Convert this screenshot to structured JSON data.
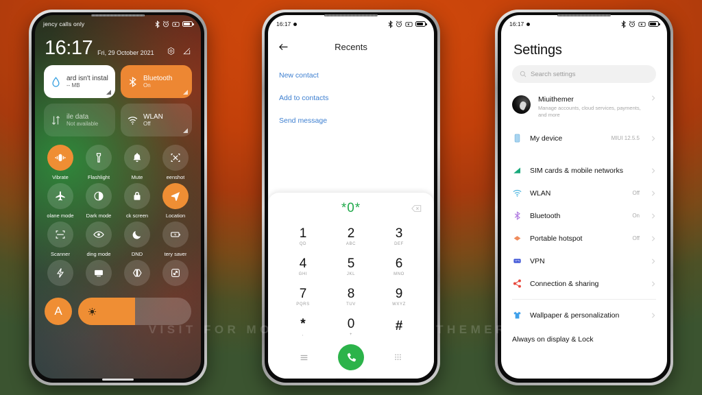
{
  "background": {
    "top_color": "#c9420b",
    "bottom_color": "#37522f"
  },
  "watermark": {
    "text": "VISIT FOR MORE THEMES - MIUITHEMER.COM"
  },
  "phone1": {
    "name": "control-center",
    "statusbar": {
      "carrier": "jency calls only",
      "icons": [
        "bluetooth-icon",
        "alarm-icon",
        "vibrate-icon",
        "battery-icon"
      ]
    },
    "clock": {
      "time": "16:17",
      "date": "Fri, 29 October 2021"
    },
    "header_icons": [
      "settings-gear-icon",
      "edit-icon"
    ],
    "tiles": [
      {
        "title": "ard isn't instal",
        "subtitle": "-- MB",
        "icon": "water-drop-icon",
        "style": "white"
      },
      {
        "title": "Bluetooth",
        "subtitle": "On",
        "icon": "bluetooth-icon",
        "style": "orange"
      },
      {
        "title": "ile data",
        "subtitle": "Not available",
        "icon": "data-arrows-icon",
        "style": "dimgreen"
      },
      {
        "title": "WLAN",
        "subtitle": "Off",
        "icon": "wifi-icon",
        "style": "dimgrey"
      }
    ],
    "toggles": [
      {
        "label": "Vibrate",
        "icon": "vibrate-icon",
        "active": true
      },
      {
        "label": "Flashlight",
        "icon": "flashlight-icon",
        "active": false
      },
      {
        "label": "Mute",
        "icon": "bell-icon",
        "active": false
      },
      {
        "label": "eenshot",
        "icon": "screenshot-icon",
        "active": false
      },
      {
        "label": "olane mode",
        "icon": "airplane-icon",
        "active": false
      },
      {
        "label": "Dark mode",
        "icon": "contrast-icon",
        "active": false
      },
      {
        "label": "ck screen",
        "icon": "lock-icon",
        "active": false
      },
      {
        "label": "Location",
        "icon": "location-arrow-icon",
        "active": true
      },
      {
        "label": "Scanner",
        "icon": "scan-frame-icon",
        "active": false
      },
      {
        "label": "ding mode",
        "icon": "eye-icon",
        "active": false
      },
      {
        "label": "DND",
        "icon": "moon-icon",
        "active": false
      },
      {
        "label": "tery saver",
        "icon": "battery-saver-icon",
        "active": false
      },
      {
        "label": "",
        "icon": "lightning-icon",
        "active": false
      },
      {
        "label": "",
        "icon": "cast-icon",
        "active": false
      },
      {
        "label": "",
        "icon": "ultra-battery-icon",
        "active": false
      },
      {
        "label": "",
        "icon": "rotate-screen-icon",
        "active": false
      }
    ],
    "brightness": {
      "auto_label": "A",
      "icon": "sun-icon",
      "level_percent": 50
    }
  },
  "phone2": {
    "name": "dialer",
    "statusbar": {
      "time": "16:17",
      "icons": [
        "bluetooth-icon",
        "alarm-icon",
        "vibrate-icon",
        "battery-icon"
      ]
    },
    "appbar": {
      "back_icon": "back-arrow-icon",
      "title": "Recents"
    },
    "links": [
      "New contact",
      "Add to contacts",
      "Send message"
    ],
    "dial_display": {
      "value": "*0*",
      "backspace_icon": "backspace-icon"
    },
    "keys": [
      {
        "digit": "1",
        "letters": "QD"
      },
      {
        "digit": "2",
        "letters": "ABC"
      },
      {
        "digit": "3",
        "letters": "DEF"
      },
      {
        "digit": "4",
        "letters": "GHI"
      },
      {
        "digit": "5",
        "letters": "JKL"
      },
      {
        "digit": "6",
        "letters": "MNO"
      },
      {
        "digit": "7",
        "letters": "PQRS"
      },
      {
        "digit": "8",
        "letters": "TUV"
      },
      {
        "digit": "9",
        "letters": "WXYZ"
      },
      {
        "digit": "*",
        "letters": ","
      },
      {
        "digit": "0",
        "letters": "+"
      },
      {
        "digit": "#",
        "letters": ""
      }
    ],
    "actions": {
      "left_icon": "list-icon",
      "call_icon": "phone-handset-icon",
      "right_icon": "keypad-grid-icon"
    }
  },
  "phone3": {
    "name": "settings",
    "statusbar": {
      "time": "16:17",
      "icons": [
        "bluetooth-icon",
        "alarm-icon",
        "vibrate-icon",
        "battery-icon"
      ]
    },
    "title": "Settings",
    "search": {
      "placeholder": "Search settings",
      "icon": "search-icon"
    },
    "account": {
      "name": "Miuithemer",
      "description": "Manage accounts, cloud services, payments, and more",
      "icon": "avatar"
    },
    "items": [
      {
        "label": "My device",
        "value": "MIUI 12.5.5",
        "icon": "device-icon",
        "color": "#9cc8ea"
      },
      {
        "label": "SIM cards & mobile networks",
        "value": "",
        "icon": "signal-icon",
        "color": "#18a97b"
      },
      {
        "label": "WLAN",
        "value": "Off",
        "icon": "wifi-icon",
        "color": "#4db6e0"
      },
      {
        "label": "Bluetooth",
        "value": "On",
        "icon": "bluetooth-icon",
        "color": "#b07ae0"
      },
      {
        "label": "Portable hotspot",
        "value": "Off",
        "icon": "hotspot-icon",
        "color": "#ef8b5c"
      },
      {
        "label": "VPN",
        "value": "",
        "icon": "vpn-icon",
        "color": "#3a51d6"
      },
      {
        "label": "Connection & sharing",
        "value": "",
        "icon": "share-icon",
        "color": "#e8483c"
      },
      {
        "label": "Wallpaper & personalization",
        "value": "",
        "icon": "shirt-icon",
        "color": "#3fa0ea"
      },
      {
        "label": "Always on display & Lock",
        "value": "",
        "icon": "lock-screen-icon",
        "color": "#888888"
      }
    ]
  }
}
